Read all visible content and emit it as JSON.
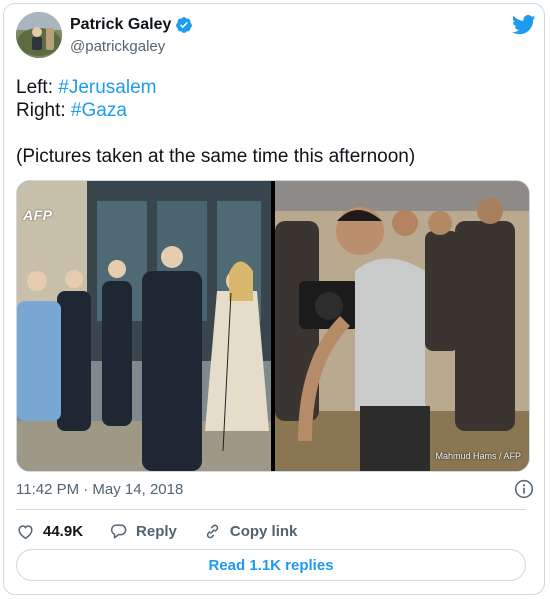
{
  "author": {
    "name": "Patrick Galey",
    "handle": "@patrickgaley",
    "verified": true
  },
  "tweet": {
    "line1_prefix": "Left: ",
    "line1_hashtag": "#Jerusalem",
    "line2_prefix": "Right: ",
    "line2_hashtag": "#Gaza",
    "line3": "(Pictures taken at the same time this afternoon)"
  },
  "media": {
    "left_watermark": "AFP",
    "right_credit": "Mahmud Hams / AFP"
  },
  "timestamp": "11:42 PM · May 14, 2018",
  "actions": {
    "like_count": "44.9K",
    "reply_label": "Reply",
    "copy_link_label": "Copy link"
  },
  "read_replies_label": "Read 1.1K replies",
  "colors": {
    "accent": "#1d9bf0",
    "text": "#0f1419",
    "muted": "#536471",
    "border": "#cfd9de"
  },
  "icons": [
    "verified-badge-icon",
    "twitter-bird-icon",
    "info-icon",
    "heart-icon",
    "reply-bubble-icon",
    "link-icon"
  ]
}
